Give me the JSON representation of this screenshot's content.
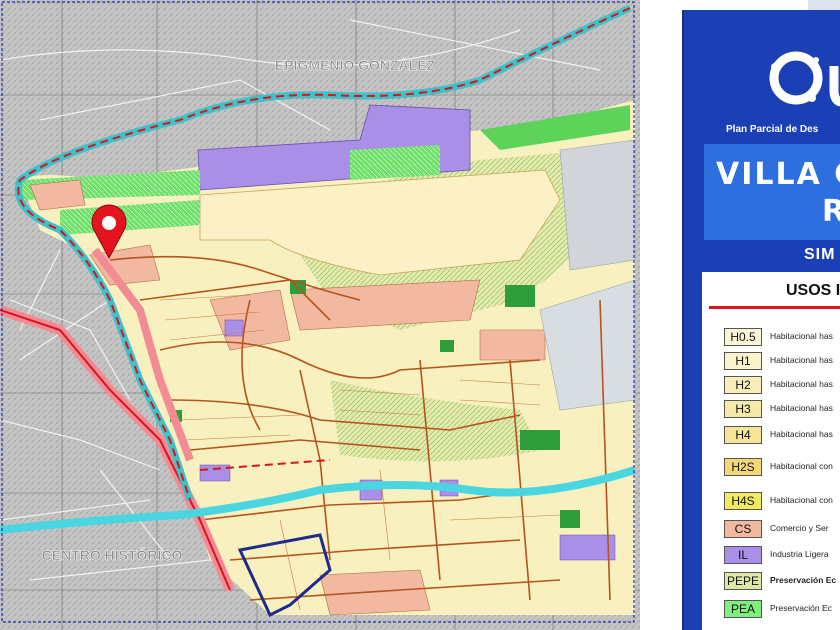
{
  "map": {
    "labels": {
      "north": "EPIGMENIO GONZÁLEZ",
      "south": "CENTRO HISTÓRICO"
    },
    "colors": {
      "urban_gray": "#c9c9c9",
      "habitational": "#f7efb3",
      "commerce": "#f2b9a0",
      "industry": "#a98fe6",
      "preservation": "#3fbf3f",
      "preservation_hatch": "#dde7a8",
      "river": "#49d6e0",
      "boundary": "#d8141c",
      "roads": "#b5541c"
    },
    "marker": "location-pin-icon"
  },
  "panel": {
    "logo": "Qu",
    "plan_text": "Plan Parcial de Des",
    "title_line1": "VILLA C",
    "title_line2": "R",
    "subtitle": "SIM",
    "legend_title": "USOS I",
    "legend": [
      {
        "code": "H0.5",
        "desc": "Habitacional has",
        "color": "#fbf6d8"
      },
      {
        "code": "H1",
        "desc": "Habitacional has",
        "color": "#fbf3c9"
      },
      {
        "code": "H2",
        "desc": "Habitacional has",
        "color": "#f9eeba"
      },
      {
        "code": "H3",
        "desc": "Habitacional has",
        "color": "#f7e9a8"
      },
      {
        "code": "H4",
        "desc": "Habitacional has",
        "color": "#f6e598"
      },
      {
        "code": "H2S",
        "desc": "Habitacional con",
        "color": "#f6d67a"
      },
      {
        "code": "H4S",
        "desc": "Habitacional con",
        "color": "#f3ea63"
      },
      {
        "code": "CS",
        "desc": "Comercio y Ser",
        "color": "#f2b9a0"
      },
      {
        "code": "IL",
        "desc": "Industria Ligera",
        "color": "#a98fe6"
      },
      {
        "code": "PEPE",
        "desc": "Preservación Ec",
        "color": "#dde7a8"
      },
      {
        "code": "PEA",
        "desc": "Preservación Ec",
        "color": "#7ff07f"
      }
    ]
  }
}
